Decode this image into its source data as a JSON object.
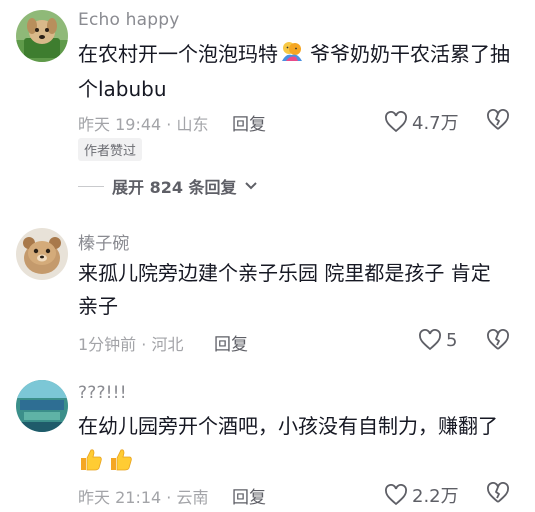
{
  "comments": [
    {
      "username": "Echo happy",
      "text_before": "在农村开一个泡泡玛特",
      "emoji": "couple-hug-emoji",
      "text_after": "爷爷奶奶干农活累了抽个labubu",
      "time_location": "昨天 19:44 · 山东",
      "reply_label": "回复",
      "likes": "4.7万",
      "badge": "作者赞过",
      "expand_label": "展开 824 条回复"
    },
    {
      "username": "榛子碗",
      "text": "来孤儿院旁边建个亲子乐园 院里都是孩子 肯定亲子",
      "time_location": "1分钟前 · 河北",
      "reply_label": "回复",
      "likes": "5"
    },
    {
      "username": "???!!!",
      "text": "在幼儿园旁开个酒吧，小孩没有自制力，赚翻了",
      "emojis": [
        "thumbs-up-emoji",
        "thumbs-up-emoji"
      ],
      "time_location": "昨天 21:14 · 云南",
      "reply_label": "回复",
      "likes": "2.2万"
    }
  ],
  "colors": {
    "text": "#161823",
    "username": "#8a8b91",
    "meta": "#a3a4a8",
    "action": "#5e5f66"
  }
}
